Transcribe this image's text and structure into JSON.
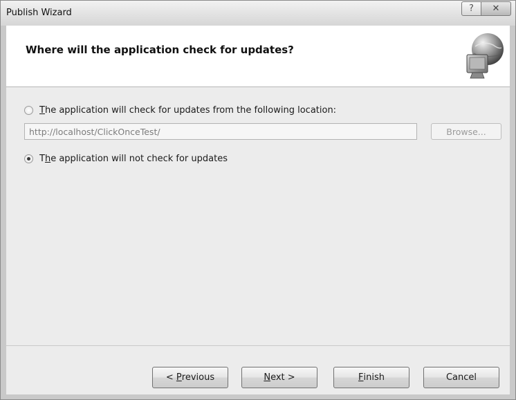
{
  "window": {
    "title": "Publish Wizard",
    "help_glyph": "?",
    "close_glyph": "✕"
  },
  "header": {
    "title": "Where will the application check for updates?",
    "icon": "globe-computer-icon"
  },
  "options": {
    "check_location": {
      "accel": "T",
      "rest": "he application will check for updates from the following location:",
      "selected": false
    },
    "location_value": "http://localhost/ClickOnceTest/",
    "browse_label": "Browse...",
    "no_check": {
      "pre": "T",
      "accel": "h",
      "rest": "e application will not check for updates",
      "selected": true
    }
  },
  "buttons": {
    "previous": {
      "pre": "< ",
      "accel": "P",
      "rest": "revious"
    },
    "next": {
      "accel": "N",
      "rest": "ext >"
    },
    "finish": {
      "accel": "F",
      "rest": "inish"
    },
    "cancel": "Cancel"
  },
  "colors": {
    "content_bg": "#ececec",
    "header_bg": "#ffffff",
    "disabled_text": "#9a9a9a"
  }
}
